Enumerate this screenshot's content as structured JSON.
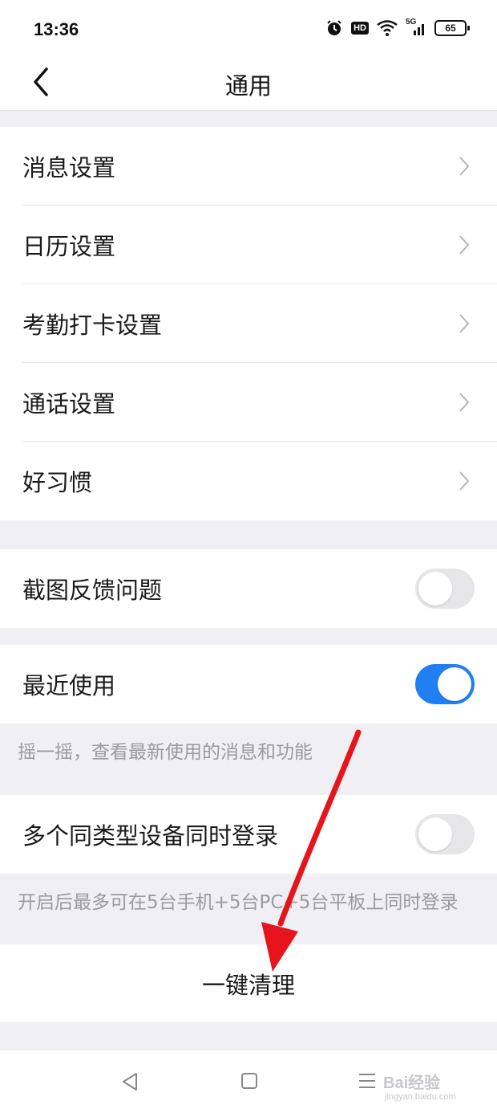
{
  "status_bar": {
    "time": "13:36",
    "hd": "HD",
    "network": "5G",
    "battery": "65"
  },
  "header": {
    "title": "通用"
  },
  "settings_group": [
    {
      "label": "消息设置"
    },
    {
      "label": "日历设置"
    },
    {
      "label": "考勤打卡设置"
    },
    {
      "label": "通话设置"
    },
    {
      "label": "好习惯"
    }
  ],
  "screenshot_feedback": {
    "label": "截图反馈问题",
    "enabled": false
  },
  "recent_use": {
    "label": "最近使用",
    "enabled": true,
    "hint": "摇一摇，查看最新使用的消息和功能"
  },
  "multi_device": {
    "label": "多个同类型设备同时登录",
    "enabled": false,
    "hint": "开启后最多可在5台手机+5台PC+5台平板上同时登录"
  },
  "clean": {
    "label": "一键清理"
  },
  "watermark": {
    "text": "Bai经验",
    "sub": "jingyan.baidu.com"
  },
  "colors": {
    "accent": "#1f7ff3",
    "annotation_arrow": "#e5151b"
  }
}
